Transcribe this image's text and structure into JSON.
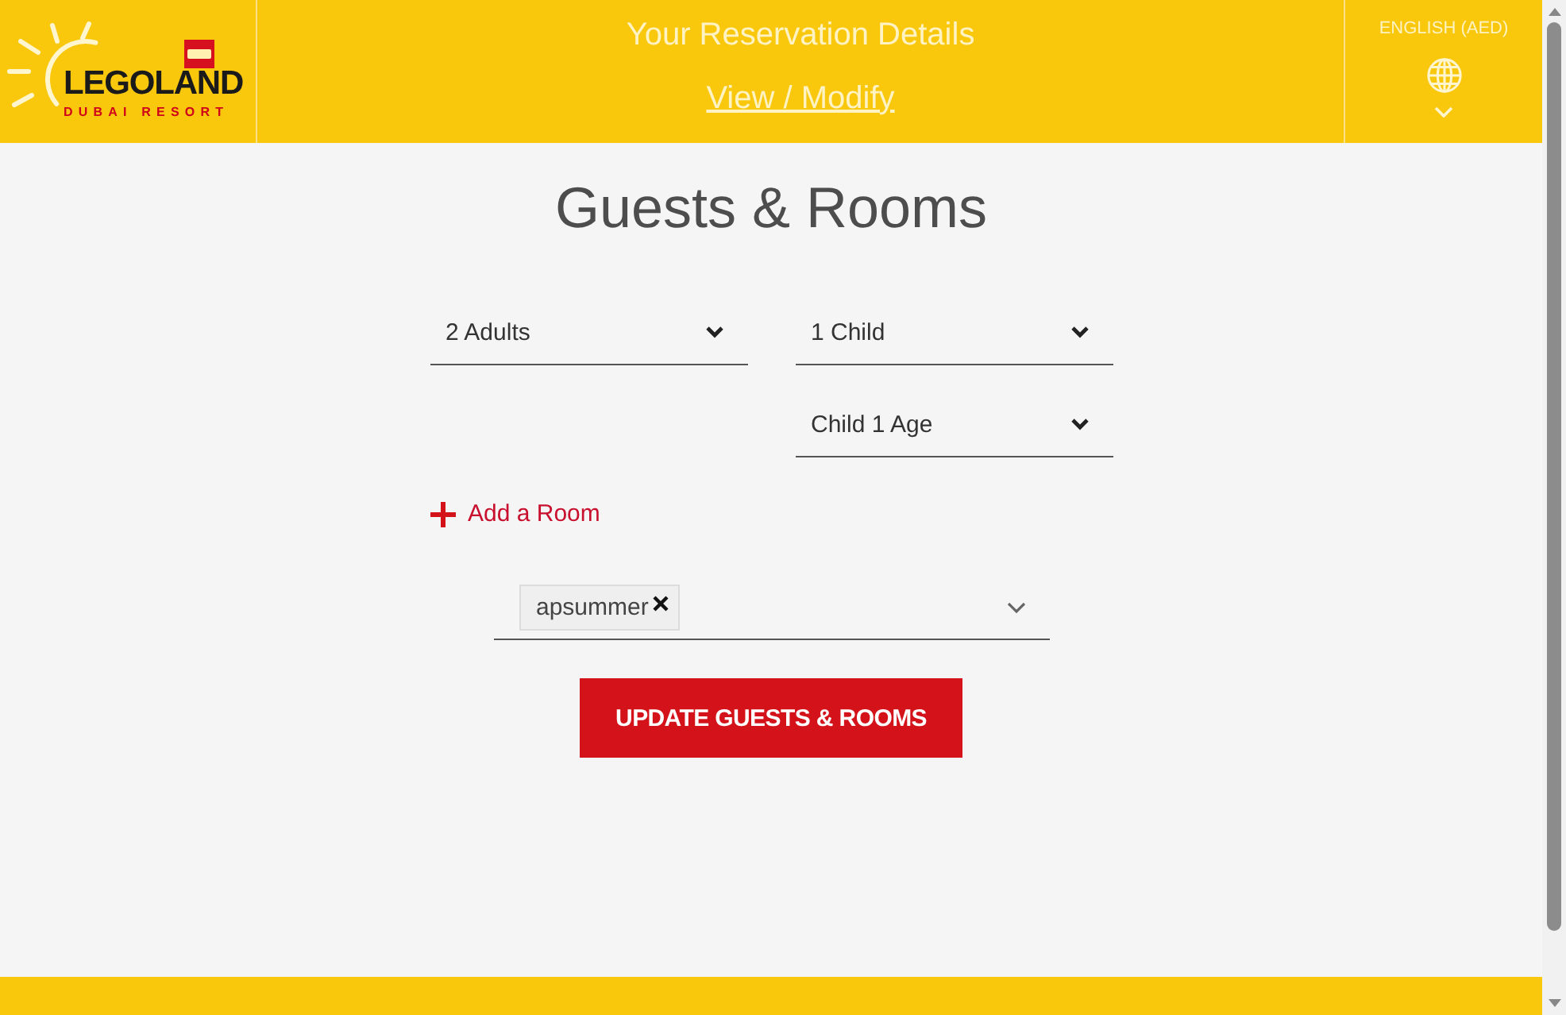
{
  "header": {
    "logo": {
      "wordmark": "LEGOLAND",
      "tagline": "DUBAI RESORT"
    },
    "title": "Your Reservation Details",
    "link": "View / Modify",
    "language": "ENGLISH (AED)"
  },
  "form": {
    "heading": "Guests & Rooms",
    "rooms": [
      {
        "adults": "2 Adults",
        "children": "1 Child",
        "child_ages": [
          "Child 1 Age"
        ]
      }
    ],
    "add_room": "Add a Room",
    "promo_codes": [
      {
        "label": "apsummer"
      }
    ],
    "submit": "UPDATE GUESTS & ROOMS"
  }
}
